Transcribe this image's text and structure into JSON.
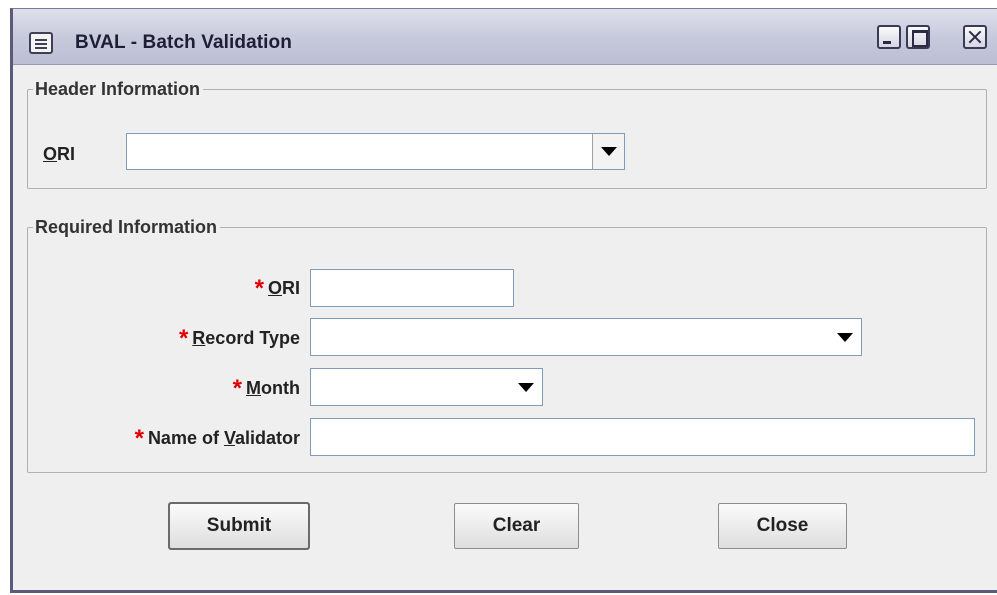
{
  "window": {
    "title": "BVAL - Batch Validation",
    "icon": "form-window-icon",
    "controls": [
      "minimize-icon",
      "maximize-icon",
      "close-icon"
    ]
  },
  "header_info": {
    "legend": "Header Information",
    "ori_label_mnemonic": "O",
    "ori_label_rest": "RI",
    "ori_value": ""
  },
  "required_info": {
    "legend": "Required Information",
    "required_marker": "*",
    "ori": {
      "mnemonic": "O",
      "rest": "RI",
      "value": ""
    },
    "record_type": {
      "mnemonic": "R",
      "rest": "ecord Type",
      "value": ""
    },
    "month": {
      "mnemonic": "M",
      "rest": "onth",
      "value": ""
    },
    "validator": {
      "prefix": "Name of ",
      "mnemonic": "V",
      "rest": "alidator",
      "value": ""
    }
  },
  "buttons": {
    "submit": "Submit",
    "clear": "Clear",
    "close": "Close"
  },
  "colors": {
    "required_star": "#e00000",
    "titlebar": "#c6c8db",
    "background": "#efefef"
  }
}
